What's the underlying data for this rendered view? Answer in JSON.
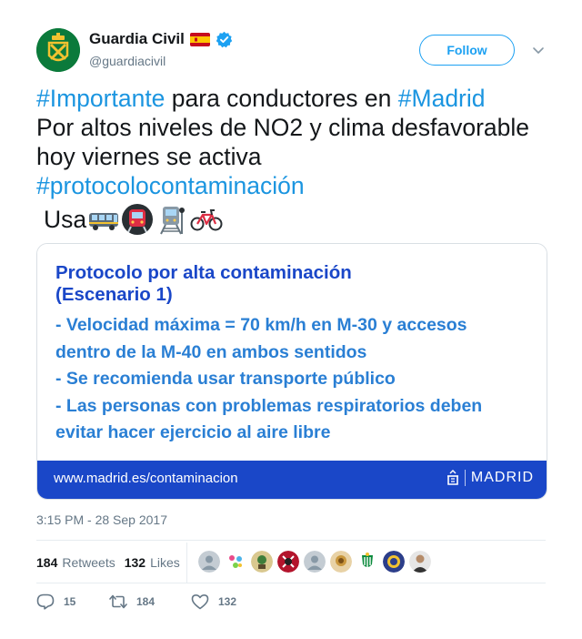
{
  "account": {
    "display_name": "Guardia Civil",
    "handle": "@guardiacivil",
    "verified": true,
    "flag": "spain-flag-icon",
    "avatar": "guardia-civil-emblem-icon"
  },
  "follow_label": "Follow",
  "tweet": {
    "segments": [
      {
        "text": "#Importante",
        "hashtag": true
      },
      {
        "text": " para conductores en ",
        "hashtag": false
      },
      {
        "text": "#Madrid",
        "hashtag": true
      },
      {
        "text": " Por altos niveles de NO2 y clima desfavorable hoy viernes se activa ",
        "hashtag": false
      },
      {
        "text": "#protocolocontaminación",
        "hashtag": true
      }
    ],
    "usa_text": "Usa",
    "emojis": [
      "bus-icon",
      "metro-icon",
      "train-icon",
      "bicycle-icon"
    ]
  },
  "card": {
    "title_line1": "Protocolo por alta contaminación",
    "title_line2": "(Escenario 1)",
    "items": [
      "- Velocidad máxima = 70 km/h en M-30 y accesos",
      "dentro de la M-40 en ambos sentidos",
      "- Se recomienda usar transporte público",
      "- Las personas con problemas respiratorios deben",
      "evitar hacer ejercicio al aire libre"
    ],
    "url": "www.madrid.es/contaminacion",
    "brand": "MADRID"
  },
  "timestamp": "3:15 PM - 28 Sep 2017",
  "stats": {
    "retweets_count": "184",
    "retweets_label": "Retweets",
    "likes_count": "132",
    "likes_label": "Likes"
  },
  "actions": {
    "reply_count": "15",
    "retweet_count": "184",
    "like_count": "132"
  },
  "colors": {
    "link": "#1b95e0",
    "accent": "#1da1f2",
    "card_blue": "#1a47c8",
    "card_light_blue": "#2a7fd4"
  }
}
